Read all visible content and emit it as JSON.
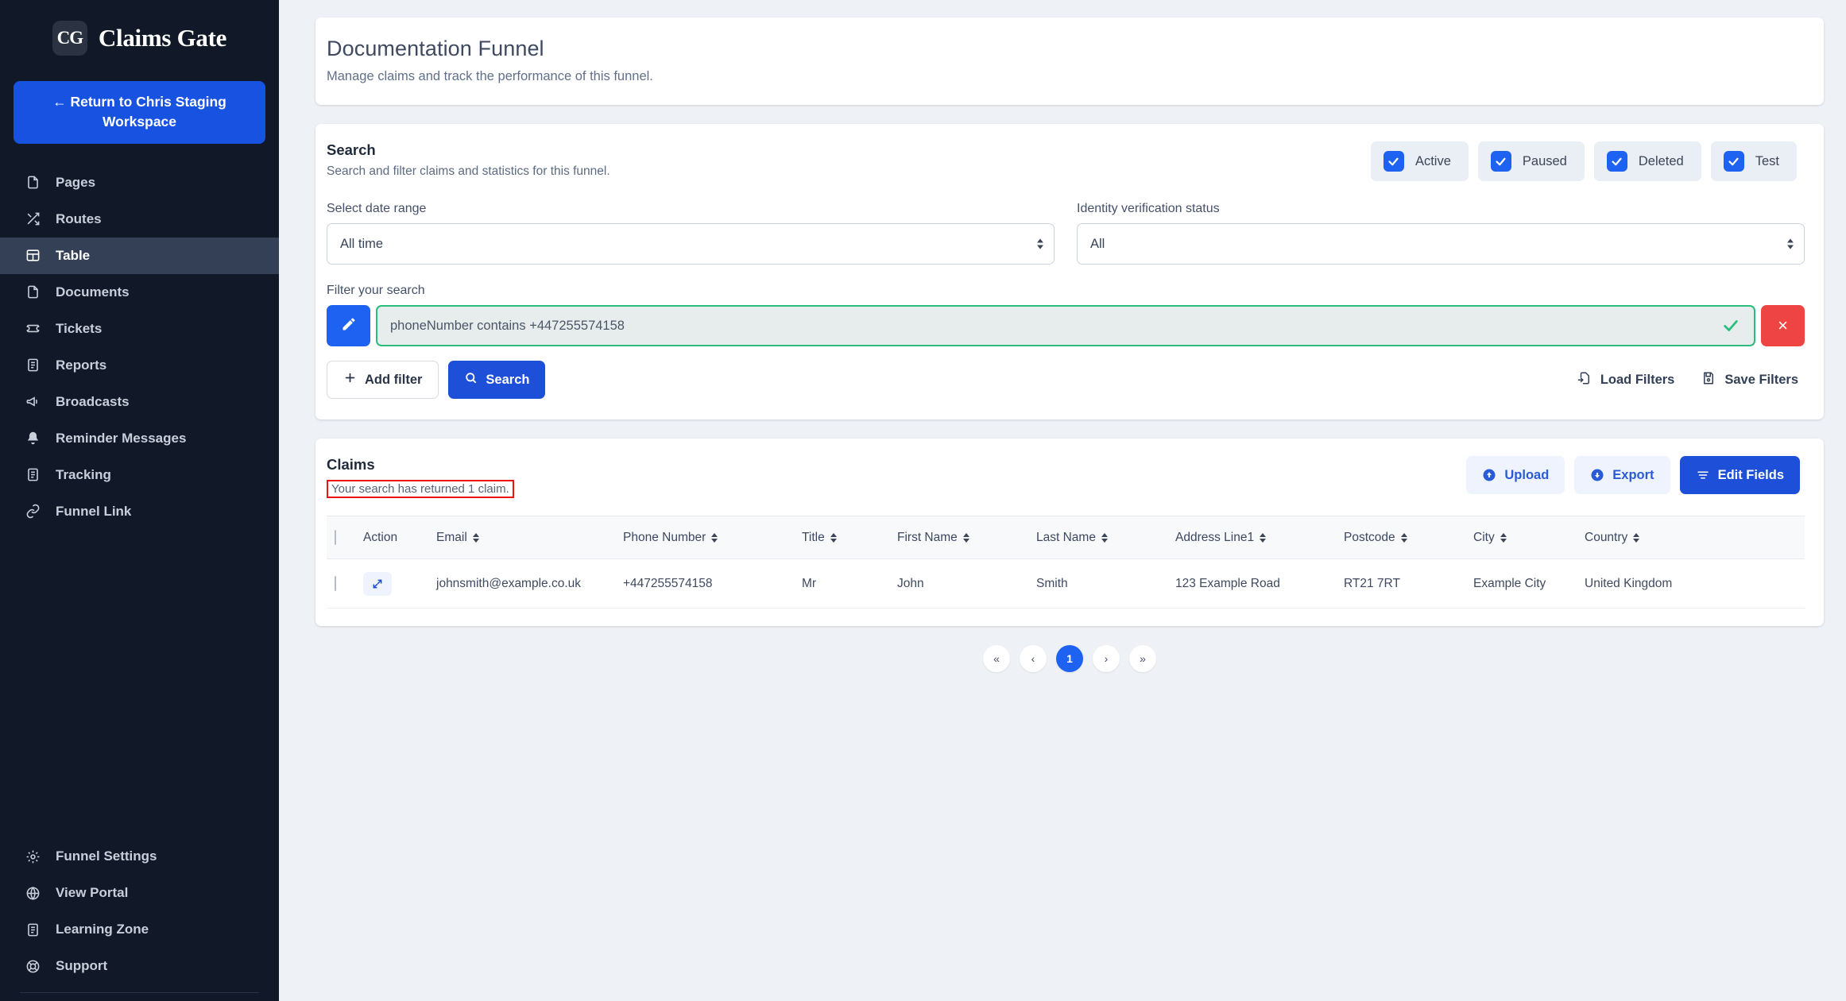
{
  "sidebar": {
    "brand": {
      "mark": "CG",
      "name": "Claims Gate"
    },
    "return_button": "← Return to Chris Staging Workspace",
    "items": [
      {
        "label": "Pages",
        "icon": "file-icon",
        "active": false
      },
      {
        "label": "Routes",
        "icon": "shuffle-icon",
        "active": false
      },
      {
        "label": "Table",
        "icon": "table-icon",
        "active": true
      },
      {
        "label": "Documents",
        "icon": "file-icon",
        "active": false
      },
      {
        "label": "Tickets",
        "icon": "ticket-icon",
        "active": false
      },
      {
        "label": "Reports",
        "icon": "report-icon",
        "active": false
      },
      {
        "label": "Broadcasts",
        "icon": "megaphone-icon",
        "active": false
      },
      {
        "label": "Reminder Messages",
        "icon": "bell-icon",
        "active": false
      },
      {
        "label": "Tracking",
        "icon": "list-icon",
        "active": false
      },
      {
        "label": "Funnel Link",
        "icon": "link-icon",
        "active": false
      }
    ],
    "bottom_items": [
      {
        "label": "Funnel Settings",
        "icon": "gear-icon"
      },
      {
        "label": "View Portal",
        "icon": "globe-icon"
      },
      {
        "label": "Learning Zone",
        "icon": "book-icon"
      },
      {
        "label": "Support",
        "icon": "lifebuoy-icon"
      }
    ]
  },
  "header": {
    "title": "Documentation Funnel",
    "subtitle": "Manage claims and track the performance of this funnel."
  },
  "search": {
    "title": "Search",
    "subtitle": "Search and filter claims and statistics for this funnel.",
    "status_filters": [
      {
        "label": "Active",
        "checked": true
      },
      {
        "label": "Paused",
        "checked": true
      },
      {
        "label": "Deleted",
        "checked": true
      },
      {
        "label": "Test",
        "checked": true
      }
    ],
    "date_range": {
      "label": "Select date range",
      "value": "All time"
    },
    "identity_status": {
      "label": "Identity verification status",
      "value": "All"
    },
    "filter_label": "Filter your search",
    "filter_value": "phoneNumber contains +447255574158",
    "filter_placeholder": "phoneNumber contains +447255574158",
    "add_filter_label": "Add filter",
    "search_label": "Search",
    "load_filters_label": "Load Filters",
    "save_filters_label": "Save Filters",
    "remove_filter_label": "×"
  },
  "claims": {
    "title": "Claims",
    "result_text": "Your search has returned 1 claim.",
    "upload_label": "Upload",
    "export_label": "Export",
    "edit_fields_label": "Edit Fields",
    "columns": [
      "Action",
      "Email",
      "Phone Number",
      "Title",
      "First Name",
      "Last Name",
      "Address Line1",
      "Postcode",
      "City",
      "Country"
    ],
    "rows": [
      {
        "email": "johnsmith@example.co.uk",
        "phone": "+447255574158",
        "title": "Mr",
        "first_name": "John",
        "last_name": "Smith",
        "address1": "123 Example Road",
        "postcode": "RT21 7RT",
        "city": "Example City",
        "country": "United Kingdom"
      }
    ]
  },
  "pagination": {
    "first": "«",
    "prev": "‹",
    "current": "1",
    "next": "›",
    "last": "»"
  },
  "colors": {
    "sidebar_bg": "#111827",
    "sidebar_active": "#344055",
    "primary": "#1d4fd8",
    "accent_blue": "#1d62f0",
    "danger": "#ef4444",
    "success": "#2bbd7e",
    "annotation": "#ee1111",
    "page_bg": "#eef1f6"
  }
}
